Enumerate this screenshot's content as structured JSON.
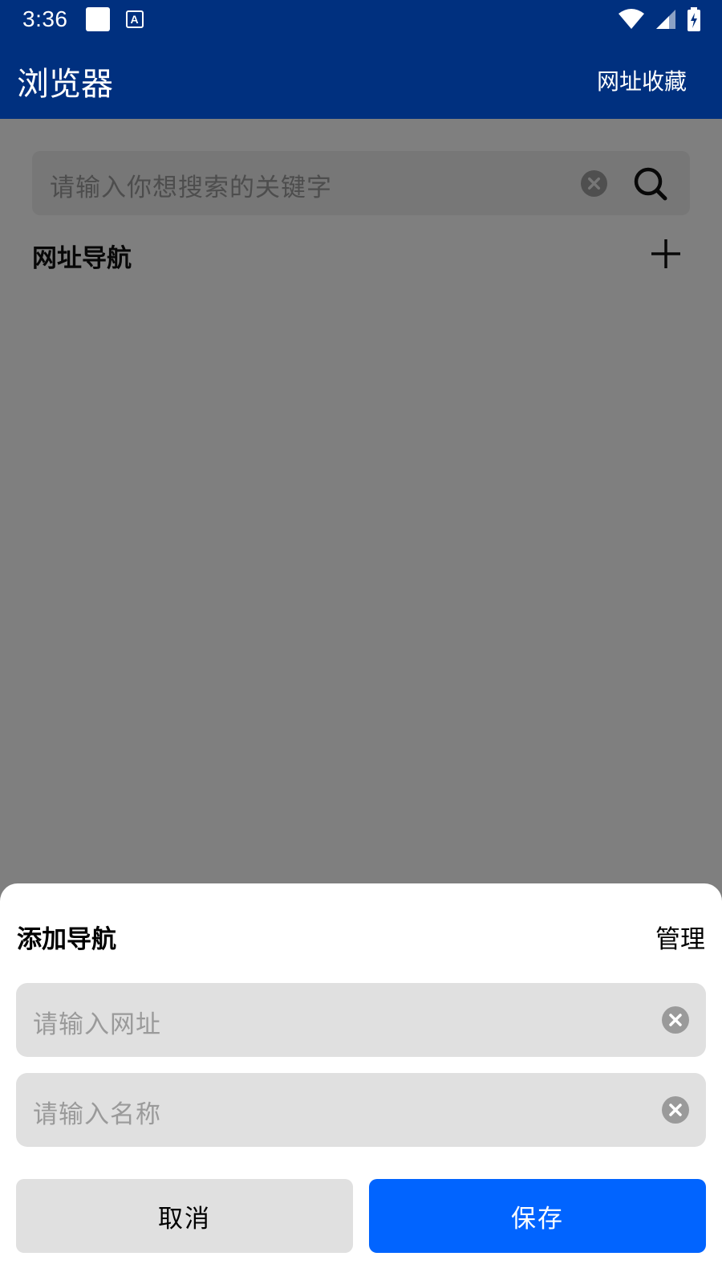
{
  "status_bar": {
    "time": "3:36",
    "notification_letter": "A"
  },
  "app_bar": {
    "title": "浏览器",
    "bookmarks_label": "网址收藏"
  },
  "search": {
    "placeholder": "请输入你想搜索的关键字"
  },
  "nav_section": {
    "title": "网址导航"
  },
  "sheet": {
    "title": "添加导航",
    "manage_label": "管理",
    "url_placeholder": "请输入网址",
    "name_placeholder": "请输入名称",
    "cancel_label": "取消",
    "save_label": "保存"
  },
  "colors": {
    "primary_dark": "#00307f",
    "accent_blue": "#0164ff",
    "field_bg": "#e0e0e0"
  }
}
